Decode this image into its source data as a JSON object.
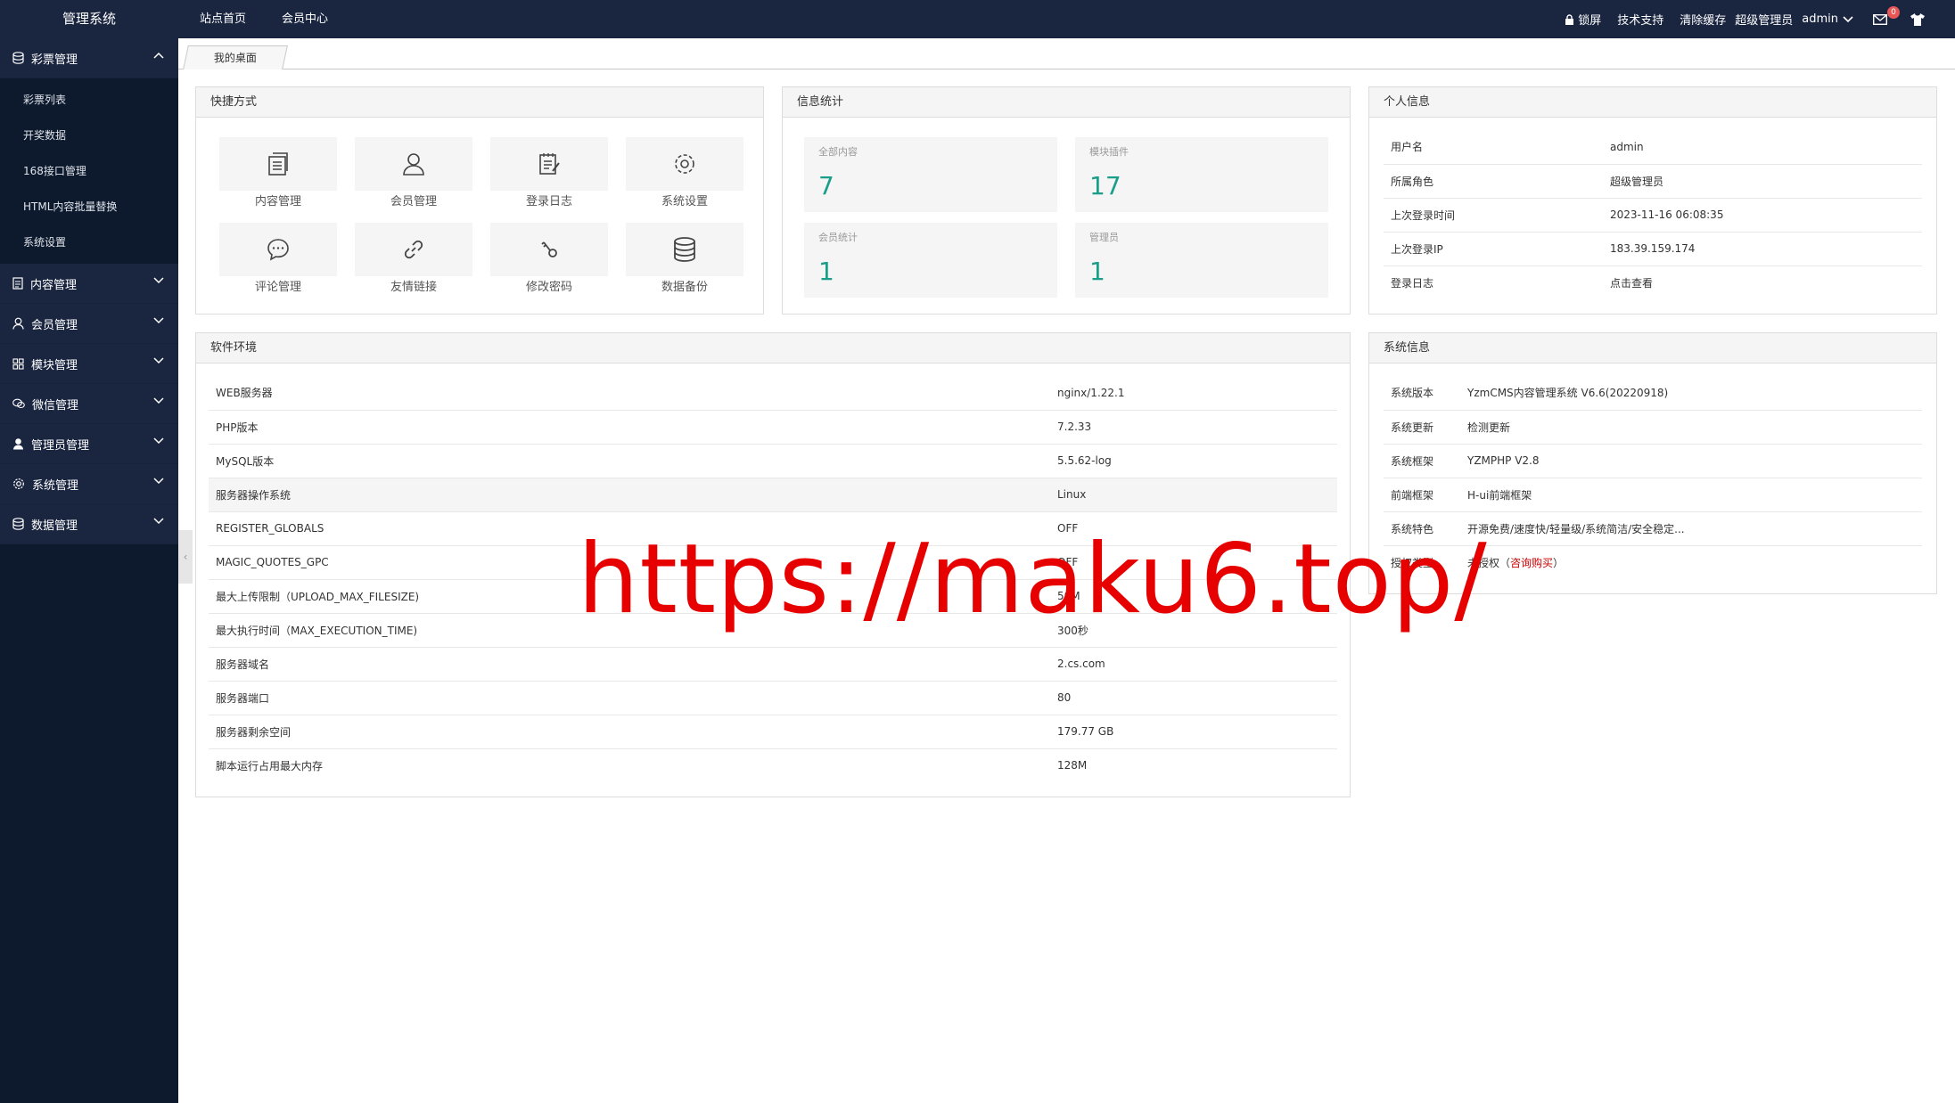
{
  "brand": "管理系统",
  "topnav": [
    "站点首页",
    "会员中心"
  ],
  "topright": {
    "lock": "锁屏",
    "support": "技术支持",
    "clear_cache": "清除缓存",
    "role": "超级管理员",
    "user": "admin",
    "mail_count": "0"
  },
  "sidebar": {
    "groups": [
      {
        "label": "彩票管理",
        "icon": "database-icon",
        "expanded": true,
        "items": [
          "彩票列表",
          "开奖数据",
          "168接口管理",
          "HTML内容批量替换",
          "系统设置"
        ]
      },
      {
        "label": "内容管理",
        "icon": "document-icon"
      },
      {
        "label": "会员管理",
        "icon": "user-icon"
      },
      {
        "label": "模块管理",
        "icon": "grid-icon"
      },
      {
        "label": "微信管理",
        "icon": "wechat-icon"
      },
      {
        "label": "管理员管理",
        "icon": "admin-icon"
      },
      {
        "label": "系统管理",
        "icon": "gear-icon"
      },
      {
        "label": "数据管理",
        "icon": "database-icon"
      }
    ]
  },
  "tabs": [
    "我的桌面"
  ],
  "shortcuts": {
    "title": "快捷方式",
    "items": [
      {
        "label": "内容管理",
        "icon": "document-icon"
      },
      {
        "label": "会员管理",
        "icon": "user-icon"
      },
      {
        "label": "登录日志",
        "icon": "log-icon"
      },
      {
        "label": "系统设置",
        "icon": "gear-icon"
      },
      {
        "label": "评论管理",
        "icon": "comment-icon"
      },
      {
        "label": "友情链接",
        "icon": "link-icon"
      },
      {
        "label": "修改密码",
        "icon": "key-icon"
      },
      {
        "label": "数据备份",
        "icon": "database-icon"
      }
    ]
  },
  "stats": {
    "title": "信息统计",
    "items": [
      {
        "label": "全部内容",
        "value": "7"
      },
      {
        "label": "模块插件",
        "value": "17"
      },
      {
        "label": "会员统计",
        "value": "1"
      },
      {
        "label": "管理员",
        "value": "1"
      }
    ]
  },
  "personal": {
    "title": "个人信息",
    "rows": [
      {
        "k": "用户名",
        "v": "admin"
      },
      {
        "k": "所属角色",
        "v": "超级管理员"
      },
      {
        "k": "上次登录时间",
        "v": "2023-11-16 06:08:35"
      },
      {
        "k": "上次登录IP",
        "v": "183.39.159.174"
      },
      {
        "k": "登录日志",
        "v": "点击查看"
      }
    ]
  },
  "software": {
    "title": "软件环境",
    "rows": [
      {
        "k": "WEB服务器",
        "v": "nginx/1.22.1"
      },
      {
        "k": "PHP版本",
        "v": "7.2.33"
      },
      {
        "k": "MySQL版本",
        "v": "5.5.62-log"
      },
      {
        "k": "服务器操作系统",
        "v": "Linux"
      },
      {
        "k": "REGISTER_GLOBALS",
        "v": "OFF"
      },
      {
        "k": "MAGIC_QUOTES_GPC",
        "v": "OFF"
      },
      {
        "k": "最大上传限制（UPLOAD_MAX_FILESIZE)",
        "v": "50M"
      },
      {
        "k": "最大执行时间（MAX_EXECUTION_TIME)",
        "v": "300秒"
      },
      {
        "k": "服务器域名",
        "v": "2.cs.com"
      },
      {
        "k": "服务器端口",
        "v": "80"
      },
      {
        "k": "服务器剩余空间",
        "v": "179.77 GB"
      },
      {
        "k": "脚本运行占用最大内存",
        "v": "128M"
      }
    ]
  },
  "sysinfo": {
    "title": "系统信息",
    "rows": [
      {
        "k": "系统版本",
        "v": "YzmCMS内容管理系统 V6.6(20220918)"
      },
      {
        "k": "系统更新",
        "v": "检测更新"
      },
      {
        "k": "系统框架",
        "v": "YZMPHP V2.8"
      },
      {
        "k": "前端框架",
        "v": "H-ui前端框架"
      },
      {
        "k": "系统特色",
        "v": "开源免费/速度快/轻量级/系统简洁/安全稳定..."
      }
    ],
    "license_key": "授权类型",
    "license_value": "未授权（",
    "license_link": "咨询购买",
    "license_close": "）"
  },
  "watermark": "https://maku6.top/"
}
